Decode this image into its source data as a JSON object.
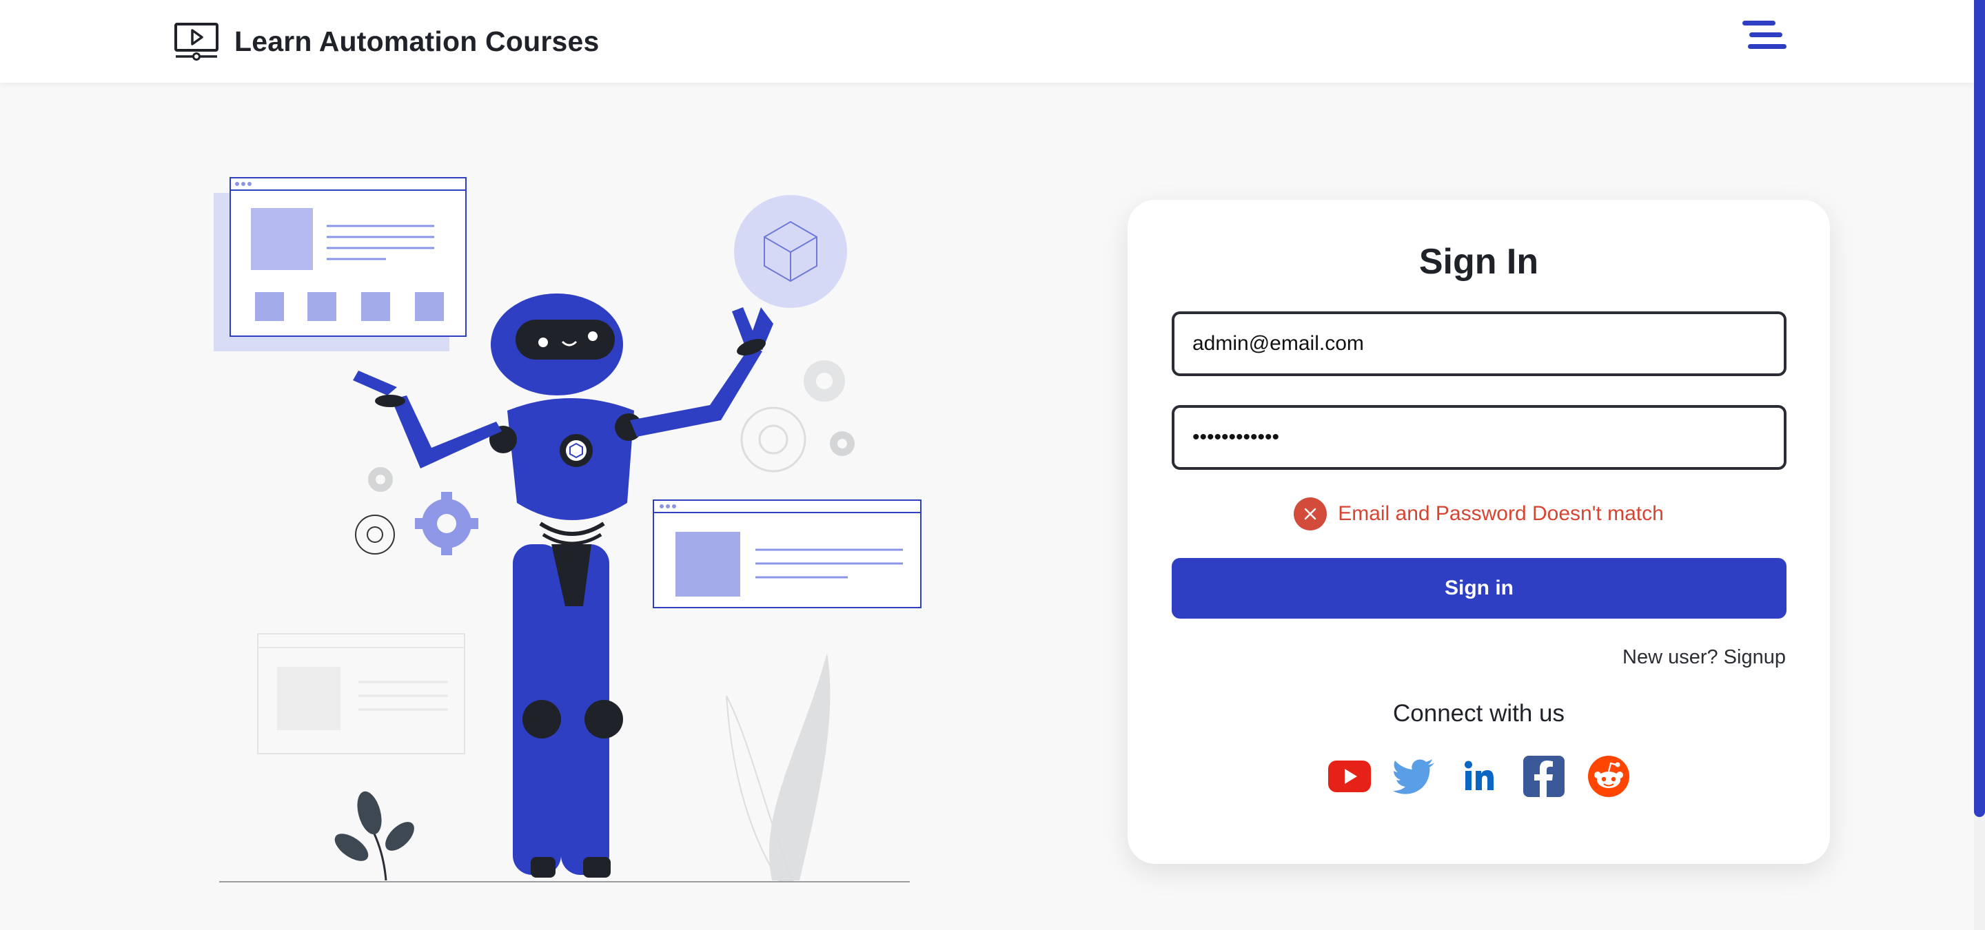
{
  "header": {
    "title": "Learn Automation Courses",
    "brand_icon": "video-monitor-icon",
    "menu_icon": "hamburger-menu-icon"
  },
  "login": {
    "title": "Sign In",
    "email_value": "admin@email.com",
    "password_value": "••••••••••••",
    "error_message": "Email and Password Doesn't match",
    "submit_label": "Sign in",
    "signup_link": "New user? Signup",
    "connect_label": "Connect with us"
  },
  "socials": [
    {
      "name": "youtube-icon",
      "color": "#e62117"
    },
    {
      "name": "twitter-icon",
      "color": "#5a9ee6"
    },
    {
      "name": "linkedin-icon",
      "color": "#0a66c2"
    },
    {
      "name": "facebook-icon",
      "color": "#3b5998"
    },
    {
      "name": "reddit-icon",
      "color": "#ff4500"
    }
  ],
  "colors": {
    "accent": "#2e3fc4",
    "error": "#d64532",
    "background": "#f7f8f7"
  }
}
